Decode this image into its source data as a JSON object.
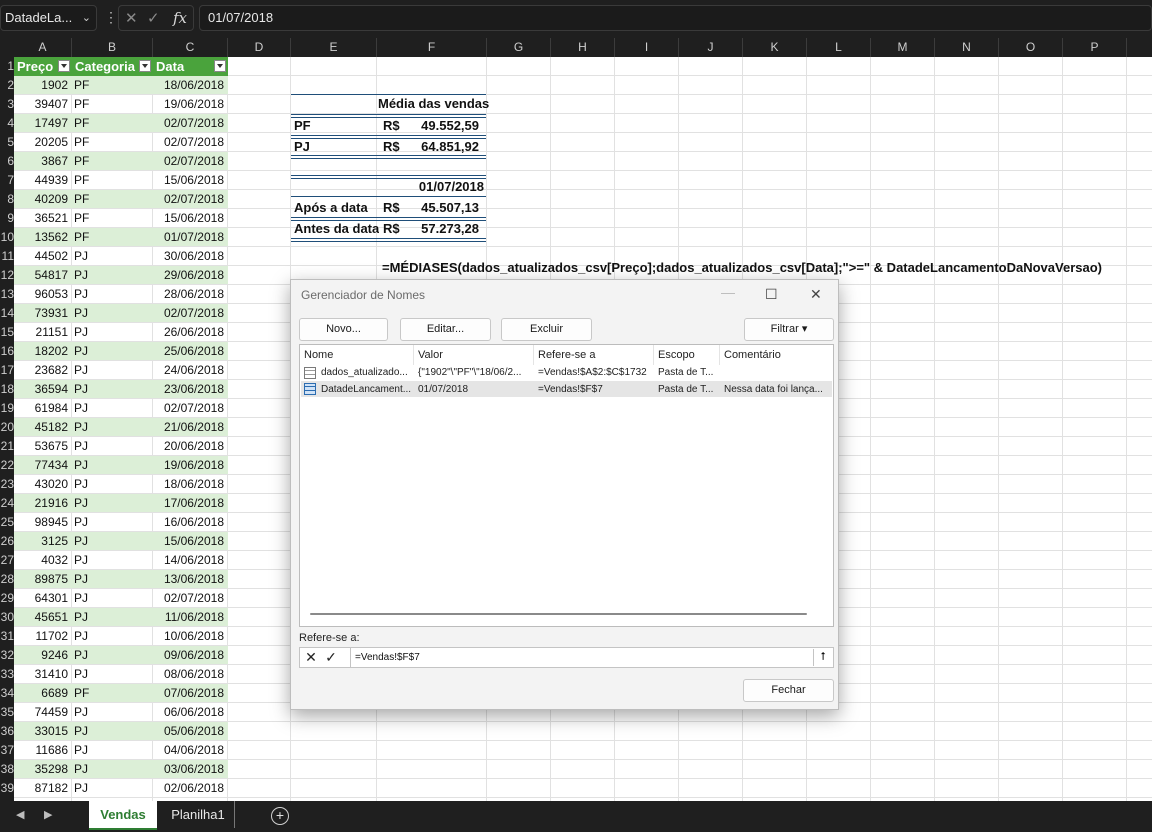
{
  "formula_bar": {
    "name_box": "DatadeLa...",
    "name_box_icon": "chevron-down-icon",
    "cancel_icon": "close-icon",
    "enter_icon": "checkmark-icon",
    "fx_label": "fx",
    "content": "01/07/2018"
  },
  "columns": [
    "A",
    "B",
    "C",
    "D",
    "E",
    "F",
    "G",
    "H",
    "I",
    "J",
    "K",
    "L",
    "M",
    "N",
    "O",
    "P"
  ],
  "row_numbers": [
    "1",
    "2",
    "3",
    "4",
    "5",
    "6",
    "7",
    "8",
    "9",
    "10",
    "11",
    "12",
    "13",
    "14",
    "15",
    "16",
    "17",
    "18",
    "19",
    "20",
    "21",
    "22",
    "23",
    "24",
    "25",
    "26",
    "27",
    "28",
    "29",
    "30",
    "31",
    "32",
    "33",
    "34",
    "35",
    "36",
    "37",
    "38",
    "39"
  ],
  "table": {
    "headers": [
      "Preço",
      "Categoria",
      "Data"
    ],
    "rows": [
      [
        "1902",
        "PF",
        "18/06/2018"
      ],
      [
        "39407",
        "PF",
        "19/06/2018"
      ],
      [
        "17497",
        "PF",
        "02/07/2018"
      ],
      [
        "20205",
        "PF",
        "02/07/2018"
      ],
      [
        "3867",
        "PF",
        "02/07/2018"
      ],
      [
        "44939",
        "PF",
        "15/06/2018"
      ],
      [
        "40209",
        "PF",
        "02/07/2018"
      ],
      [
        "36521",
        "PF",
        "15/06/2018"
      ],
      [
        "13562",
        "PF",
        "01/07/2018"
      ],
      [
        "44502",
        "PJ",
        "30/06/2018"
      ],
      [
        "54817",
        "PJ",
        "29/06/2018"
      ],
      [
        "96053",
        "PJ",
        "28/06/2018"
      ],
      [
        "73931",
        "PJ",
        "02/07/2018"
      ],
      [
        "21151",
        "PJ",
        "26/06/2018"
      ],
      [
        "18202",
        "PJ",
        "25/06/2018"
      ],
      [
        "23682",
        "PJ",
        "24/06/2018"
      ],
      [
        "36594",
        "PJ",
        "23/06/2018"
      ],
      [
        "61984",
        "PJ",
        "02/07/2018"
      ],
      [
        "45182",
        "PJ",
        "21/06/2018"
      ],
      [
        "53675",
        "PJ",
        "20/06/2018"
      ],
      [
        "77434",
        "PJ",
        "19/06/2018"
      ],
      [
        "43020",
        "PJ",
        "18/06/2018"
      ],
      [
        "21916",
        "PJ",
        "17/06/2018"
      ],
      [
        "98945",
        "PJ",
        "16/06/2018"
      ],
      [
        "3125",
        "PJ",
        "15/06/2018"
      ],
      [
        "4032",
        "PJ",
        "14/06/2018"
      ],
      [
        "89875",
        "PJ",
        "13/06/2018"
      ],
      [
        "64301",
        "PJ",
        "02/07/2018"
      ],
      [
        "45651",
        "PJ",
        "11/06/2018"
      ],
      [
        "11702",
        "PJ",
        "10/06/2018"
      ],
      [
        "9246",
        "PJ",
        "09/06/2018"
      ],
      [
        "31410",
        "PJ",
        "08/06/2018"
      ],
      [
        "6689",
        "PF",
        "07/06/2018"
      ],
      [
        "74459",
        "PJ",
        "06/06/2018"
      ],
      [
        "33015",
        "PJ",
        "05/06/2018"
      ],
      [
        "11686",
        "PJ",
        "04/06/2018"
      ],
      [
        "35298",
        "PJ",
        "03/06/2018"
      ],
      [
        "87182",
        "PJ",
        "02/06/2018"
      ]
    ]
  },
  "summary": {
    "title": "Média das vendas",
    "pf_label": "PF",
    "pf_currency": "R$",
    "pf_value": "49.552,59",
    "pj_label": "PJ",
    "pj_currency": "R$",
    "pj_value": "64.851,92",
    "date": "01/07/2018",
    "after_label": "Após a data",
    "after_currency": "R$",
    "after_value": "45.507,13",
    "before_label": "Antes da data",
    "before_currency": "R$",
    "before_value": "57.273,28",
    "formula_text": "=MÉDIASES(dados_atualizados_csv[Preço];dados_atualizados_csv[Data];\">=\" & DatadeLancamentoDaNovaVersao)"
  },
  "dialog": {
    "title": "Gerenciador de Nomes",
    "minimize_icon": "minimize-icon",
    "maximize_icon": "maximize-icon",
    "close_icon": "close-icon",
    "buttons": {
      "new": "Novo...",
      "edit": "Editar...",
      "delete": "Excluir",
      "filter": "Filtrar"
    },
    "list_headers": [
      "Nome",
      "Valor",
      "Refere-se a",
      "Escopo",
      "Comentário"
    ],
    "list_rows": [
      {
        "name": "dados_atualizado...",
        "value": "{\"1902\"\\\"PF\"\\\"18/06/2...",
        "refers": "=Vendas!$A$2:$C$1732",
        "scope": "Pasta de T...",
        "comment": "",
        "icon": "table-icon"
      },
      {
        "name": "DatadeLancament...",
        "value": "01/07/2018",
        "refers": "=Vendas!$F$7",
        "scope": "Pasta de T...",
        "comment": "Nessa data foi lança...",
        "icon": "named-range-icon"
      }
    ],
    "refers_label": "Refere-se a:",
    "refers_value": "=Vendas!$F$7",
    "close_button": "Fechar"
  },
  "sheet_tabs": {
    "active": "Vendas",
    "inactive": "Planilha1",
    "prev_icon": "triangle-left-icon",
    "next_icon": "triangle-right-icon",
    "add_icon": "plus-circle-icon"
  }
}
